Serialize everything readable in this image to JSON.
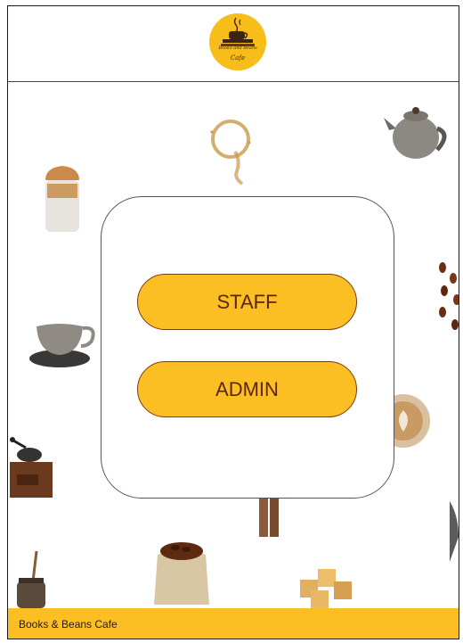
{
  "header": {
    "logo": {
      "icon": "coffee-cup-on-books-icon",
      "brand_text": "Books and Beans",
      "sub_text": "Cafe",
      "bg_color": "#f7bd1a"
    }
  },
  "login_panel": {
    "staff_label": "STAFF",
    "admin_label": "ADMIN",
    "button_color": "#fbbf24",
    "button_border_color": "#7a3b10"
  },
  "decorations": [
    "coffee-ring-stain",
    "teapot",
    "iced-coffee-cup",
    "coffee-beans",
    "teacup-saucer",
    "latte-cup",
    "coffee-grinder",
    "coffee-bean-sack",
    "honey-jar",
    "sugar-cubes",
    "cinnamon-sticks",
    "coffee-canister"
  ],
  "footer": {
    "text": "Books & Beans Cafe",
    "bg_color": "#fbbf24"
  }
}
